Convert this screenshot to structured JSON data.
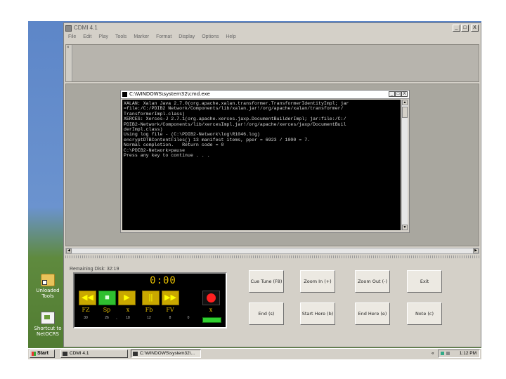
{
  "desktop": {
    "icons": [
      {
        "label_line1": "Unloaded",
        "label_line2": "Tools",
        "icon": "folder-icon"
      },
      {
        "label_line1": "Shortcut to",
        "label_line2": "NetOCRS",
        "icon": "shortcut-icon"
      }
    ]
  },
  "app": {
    "title": "CDMI 4.1",
    "window_controls": [
      "_",
      "□",
      "X"
    ],
    "menu": [
      "File",
      "Edit",
      "Play",
      "Tools",
      "Marker",
      "Format",
      "Display",
      "Options",
      "Help"
    ],
    "toolpanel_close": "×"
  },
  "cmd": {
    "title": "C:\\WINDOWS\\system32\\cmd.exe",
    "controls": [
      "_",
      "□",
      "X"
    ],
    "lines": [
      "XALAN: Xalan Java 2.7.0(org.apache.xalan.transformer.TransformerIdentityImpl; jar",
      "=file:/C:/PDIB2 Network/Components/lib/xalan.jar!/org/apache/xalan/transformer/",
      "TransformerImpl.class)",
      "XERCES: Xerces-J 2.7.1(org.apache.xerces.jaxp.DocumentBuilderImpl; jar:file:/C:/",
      "PDIB2-Network/Components/lib/xercesImpl.jar!/org/apache/xerces/jaxp/DocumentBuil",
      "derImpl.class)",
      "Using log file - (C:\\PDIB2-Network\\log\\R1046.log)",
      "encryptDTBContentFiles() 13 manifest items, pper = 6923 / 1000 = 7.",
      "Normal completion.   Return code = 0",
      "",
      "C:\\PDIB2-Network>pause",
      "Press any key to continue . . ."
    ]
  },
  "recorder": {
    "remaining_disk": "Remaining Disk: 32:19",
    "time": "0:00",
    "buttons": [
      "◀◀",
      "■",
      "▶",
      "||",
      "▶▶"
    ],
    "params": [
      {
        "label": "FZ",
        "value": "30"
      },
      {
        "label": "Sp",
        "value": "26"
      },
      {
        "label": "x",
        "value": "18"
      },
      {
        "label": "Fb",
        "value": "12"
      },
      {
        "label": "FV",
        "value": "8"
      }
    ],
    "extra_marks": [
      ",",
      "0"
    ],
    "record_label": "x"
  },
  "actions": [
    {
      "label": "Cue Tune (F8)",
      "name": "cue-tune-button"
    },
    {
      "label": "Zoom In (+)",
      "name": "zoom-in-button"
    },
    {
      "label": "Zoom Out (-)",
      "name": "zoom-out-button"
    },
    {
      "label": "Exit",
      "name": "exit-button"
    },
    {
      "label": "End (s)",
      "name": "end-button"
    },
    {
      "label": "Start Here (b)",
      "name": "start-here-button"
    },
    {
      "label": "End Here (e)",
      "name": "end-here-button"
    },
    {
      "label": "Note (c)",
      "name": "note-button"
    }
  ],
  "taskbar": {
    "start": "Start",
    "tasks": [
      "CDMI 4.1",
      "C:\\WINDOWS\\system32\\..."
    ],
    "clock": "1:12 PM",
    "tray_arrow": "«"
  },
  "colors": {
    "timer": "#e8c000",
    "transport": "#c9a800",
    "record": "#ff2020",
    "play_green": "#30c030"
  }
}
